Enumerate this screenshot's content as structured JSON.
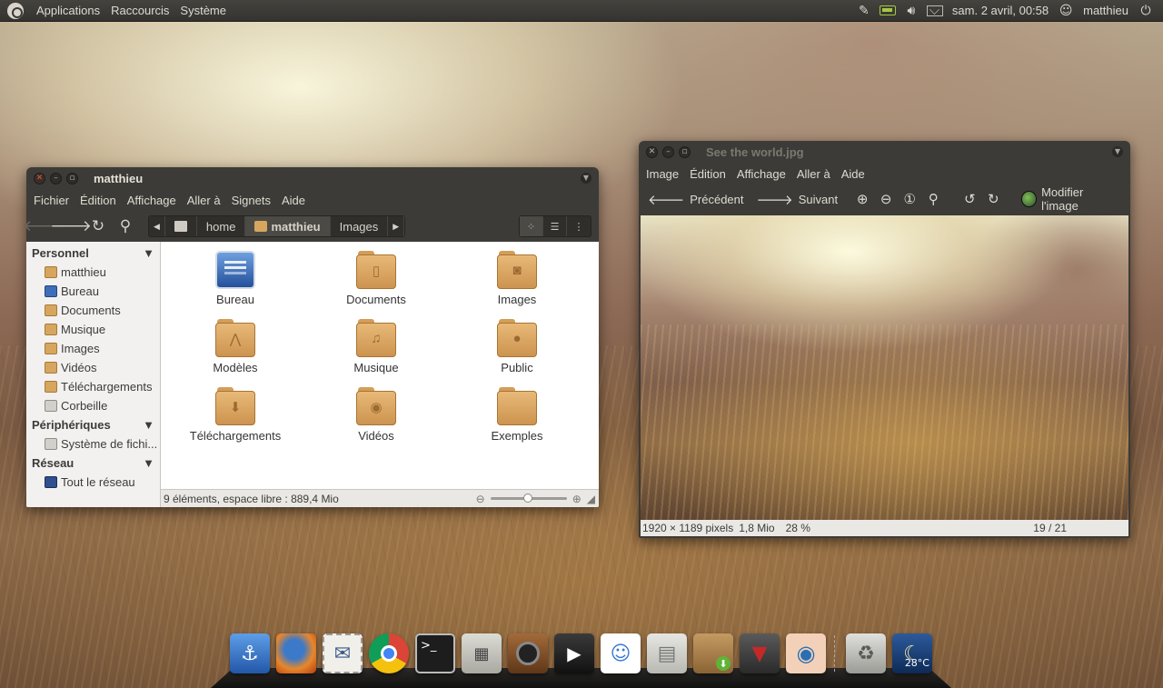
{
  "top_panel": {
    "menus": [
      "Applications",
      "Raccourcis",
      "Système"
    ],
    "clock": "sam. 2 avril, 00:58",
    "username": "matthieu",
    "tray_icons": [
      "pen-icon",
      "battery-icon",
      "volume-icon",
      "mail-icon"
    ]
  },
  "nautilus": {
    "title": "matthieu",
    "menus": [
      "Fichier",
      "Édition",
      "Affichage",
      "Aller à",
      "Signets",
      "Aide"
    ],
    "path": [
      "home",
      "matthieu",
      "Images"
    ],
    "sidebar": {
      "personnel_label": "Personnel",
      "personnel": [
        "matthieu",
        "Bureau",
        "Documents",
        "Musique",
        "Images",
        "Vidéos",
        "Téléchargements",
        "Corbeille"
      ],
      "peripheriques_label": "Périphériques",
      "peripheriques": [
        "Système de fichi..."
      ],
      "reseau_label": "Réseau",
      "reseau": [
        "Tout le réseau"
      ]
    },
    "items": [
      "Bureau",
      "Documents",
      "Images",
      "Modèles",
      "Musique",
      "Public",
      "Téléchargements",
      "Vidéos",
      "Exemples"
    ],
    "status": "9 éléments, espace libre : 889,4 Mio"
  },
  "eog": {
    "title": "See the world.jpg",
    "menus": [
      "Image",
      "Édition",
      "Affichage",
      "Aller à",
      "Aide"
    ],
    "prev": "Précédent",
    "next": "Suivant",
    "edit": "Modifier l'image",
    "dimensions": "1920 × 1189 pixels",
    "size": "1,8 Mio",
    "zoom": "28 %",
    "index": "19 / 21"
  },
  "dock": {
    "weather_temp": "28°C",
    "apps": [
      "anchor-icon",
      "firefox-icon",
      "mail-stamp-icon",
      "chrome-icon",
      "terminal-icon",
      "calculator-icon",
      "speaker-icon",
      "video-player-icon",
      "chat-icon",
      "file-cabinet-icon",
      "package-icon",
      "suit-icon",
      "eye-icon",
      "trash-icon",
      "weather-icon"
    ]
  }
}
